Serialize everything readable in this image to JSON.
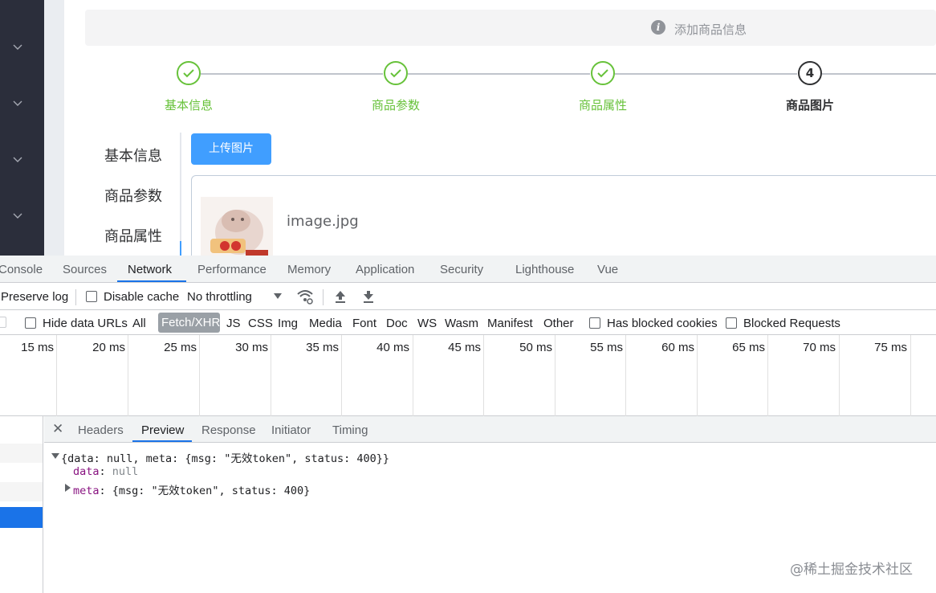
{
  "app": {
    "alert": {
      "text": "添加商品信息"
    },
    "steps": [
      {
        "title": "基本信息",
        "state": "done"
      },
      {
        "title": "商品参数",
        "state": "done"
      },
      {
        "title": "商品属性",
        "state": "done"
      },
      {
        "title": "商品图片",
        "state": "active",
        "number": "4"
      }
    ],
    "vertical_tabs": [
      "基本信息",
      "商品参数",
      "商品属性"
    ],
    "upload_button": "上传图片",
    "file": {
      "name": "image.jpg"
    }
  },
  "devtools": {
    "tabs": [
      "Console",
      "Sources",
      "Network",
      "Performance",
      "Memory",
      "Application",
      "Security",
      "Lighthouse",
      "Vue"
    ],
    "active_tab": "Network",
    "toolbar": {
      "preserve_log": "Preserve log",
      "disable_cache": "Disable cache",
      "throttling": "No throttling"
    },
    "filter": {
      "hide_data_urls": "Hide data URLs",
      "types": [
        "All",
        "Fetch/XHR",
        "JS",
        "CSS",
        "Img",
        "Media",
        "Font",
        "Doc",
        "WS",
        "Wasm",
        "Manifest",
        "Other"
      ],
      "active_type": "Fetch/XHR",
      "has_blocked_cookies": "Has blocked cookies",
      "blocked_requests": "Blocked Requests"
    },
    "timeline_labels": [
      "15 ms",
      "20 ms",
      "25 ms",
      "30 ms",
      "35 ms",
      "40 ms",
      "45 ms",
      "50 ms",
      "55 ms",
      "60 ms",
      "65 ms",
      "70 ms",
      "75 ms"
    ],
    "detail_tabs": [
      "Headers",
      "Preview",
      "Response",
      "Initiator",
      "Timing"
    ],
    "active_detail_tab": "Preview",
    "preview": {
      "summary": "{data: null, meta: {msg: \"无效token\", status: 400}}",
      "data_key": "data",
      "data_value": "null",
      "meta_key": "meta",
      "meta_value": "{msg: \"无效token\", status: 400}"
    }
  },
  "watermark": "@稀土掘金技术社区",
  "colors": {
    "success": "#67c23a",
    "primary": "#409eff",
    "sidebar": "#2b2e3b",
    "devtools_accent": "#1a73e8"
  }
}
